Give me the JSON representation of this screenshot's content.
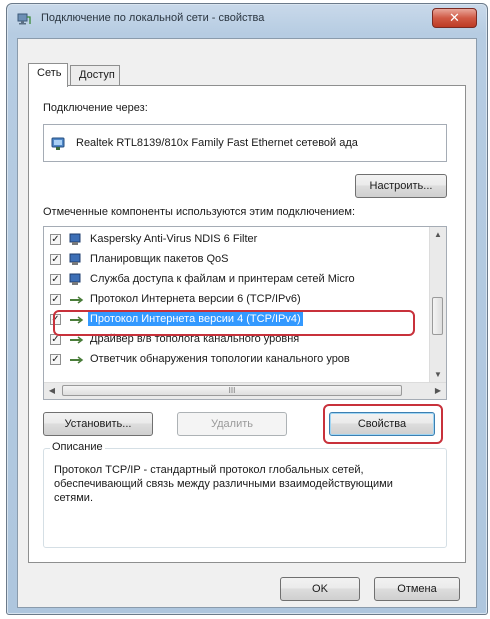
{
  "window": {
    "title": "Подключение по локальной сети - свойства",
    "close_symbol": "✕"
  },
  "tabs": [
    {
      "label": "Сеть",
      "active": true
    },
    {
      "label": "Доступ",
      "active": false
    }
  ],
  "network_tab": {
    "connect_through_label": "Подключение через:",
    "adapter_name": "Realtek RTL8139/810x Family Fast Ethernet сетевой ада",
    "configure_button": "Настроить...",
    "components_label": "Отмеченные компоненты используются этим подключением:",
    "components": [
      {
        "label": "Kaspersky Anti-Virus NDIS 6 Filter",
        "checked": true,
        "icon": "network-client-icon",
        "selected": false
      },
      {
        "label": "Планировщик пакетов QoS",
        "checked": true,
        "icon": "network-service-icon",
        "selected": false
      },
      {
        "label": "Служба доступа к файлам и принтерам сетей Micro",
        "checked": true,
        "icon": "network-service-icon",
        "selected": false
      },
      {
        "label": "Протокол Интернета версии 6 (TCP/IPv6)",
        "checked": true,
        "icon": "protocol-icon",
        "selected": false
      },
      {
        "label": "Протокол Интернета версии 4 (TCP/IPv4)",
        "checked": true,
        "icon": "protocol-icon",
        "selected": true
      },
      {
        "label": "Драйвер в/в тополога канального уровня",
        "checked": true,
        "icon": "protocol-icon",
        "selected": false
      },
      {
        "label": "Ответчик обнаружения топологии канального уров",
        "checked": true,
        "icon": "protocol-icon",
        "selected": false
      }
    ],
    "hscroll_label": "III",
    "install_button": "Установить...",
    "uninstall_button": "Удалить",
    "properties_button": "Свойства",
    "description_title": "Описание",
    "description_text": "Протокол TCP/IP - стандартный протокол глобальных сетей, обеспечивающий связь между различными взаимодействующими сетями."
  },
  "footer": {
    "ok_button": "OK",
    "cancel_button": "Отмена"
  },
  "colors": {
    "selection": "#3399ff",
    "highlight_annotation": "#c8313b",
    "close_button": "#d05a45"
  }
}
